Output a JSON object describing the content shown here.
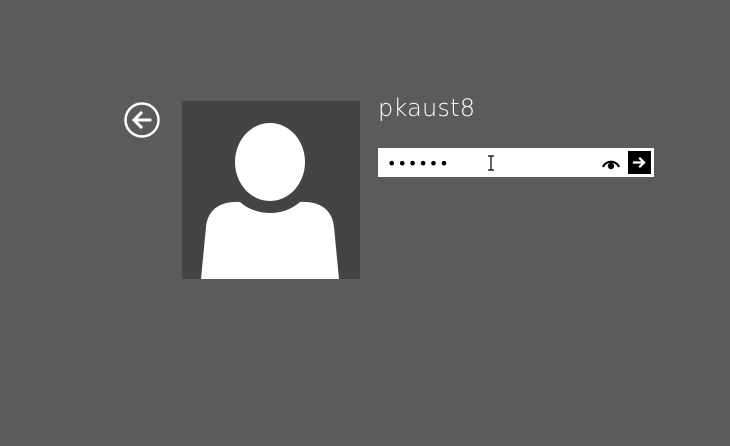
{
  "user": {
    "name": "pkaust8"
  },
  "password": {
    "value": "••••••",
    "type": "password"
  },
  "icons": {
    "back": "back-arrow-circle-icon",
    "avatar": "user-silhouette-icon",
    "reveal": "eye-icon",
    "submit": "right-arrow-icon",
    "cursor": "text-cursor-icon"
  },
  "colors": {
    "background": "#5b5b5b",
    "avatar_bg": "#444444",
    "submit_bg": "#000000",
    "text": "#ffffff"
  }
}
